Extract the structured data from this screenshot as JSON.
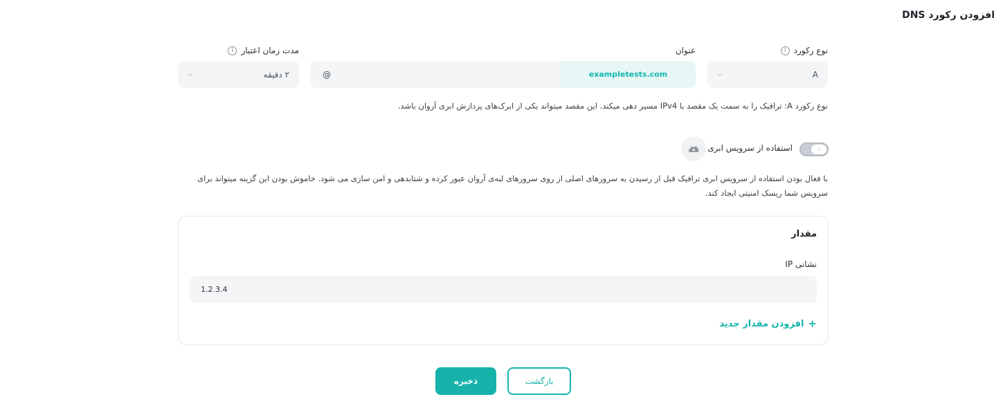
{
  "page": {
    "title": "افزودن رکورد DNS"
  },
  "record_type": {
    "label": "نوع رکورد",
    "value": "A"
  },
  "name": {
    "label": "عنوان",
    "value": "@",
    "domain": "exampletests.com"
  },
  "ttl": {
    "label": "مدت زمان اعتبار",
    "value": "۲ دقیقه"
  },
  "record_hint": "نوع رکورد A: ترافیک را به سمت یک مقصد با IPv4 مسیر دهی میکند. این مقصد میتواند یکی از ابرک‌های پردازش ابری آروان باشد.",
  "cloud_service": {
    "label": "استفاده از سرویس ابری",
    "enabled": false,
    "description_line1": "با فعال بودن استفاده از سرویس ابری ترافیک قبل از رسیدن به سرورهای اصلی از روی سرورهای لبه‌ی آروان عبور کرده و شتابدهی و امن سازی می شود. خاموش بودن این گزینه میتواند برای",
    "description_line2": "سرویس شما ریسک امنیتی ایجاد کند."
  },
  "value_card": {
    "title": "مقدار",
    "ip_label": "نشانی IP",
    "ip_value": "1.2.3.4",
    "add_label": "افزودن مقدار جدید"
  },
  "actions": {
    "save_label": "ذخیره",
    "back_label": "بازگشت"
  },
  "icons": {
    "info": "info-icon",
    "chevron": "chevron-down-icon",
    "cloud": "cloud-icon",
    "plus": "plus-icon"
  },
  "colors": {
    "accent": "#17b3ab",
    "field_bg": "#f3f5f7",
    "domain_bg": "#e6f7f6"
  }
}
